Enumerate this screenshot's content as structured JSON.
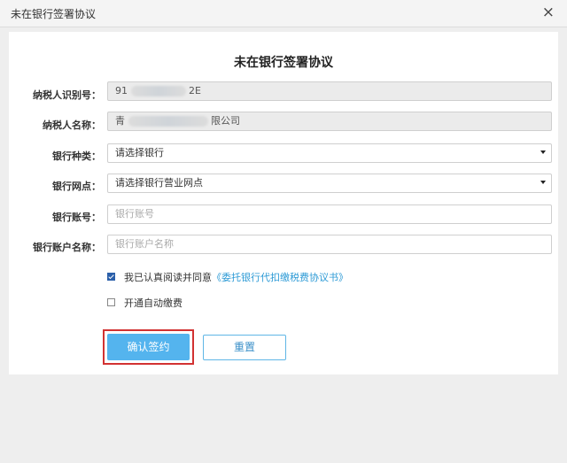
{
  "window": {
    "title": "未在银行签署协议",
    "close_glyph": "×"
  },
  "form": {
    "heading": "未在银行签署协议",
    "taxpayer_id": {
      "label": "纳税人识别号：",
      "value_prefix": "91",
      "value_suffix": "2E"
    },
    "taxpayer_name": {
      "label": "纳税人名称：",
      "value_prefix": "青",
      "value_suffix": "限公司"
    },
    "bank_type": {
      "label": "银行种类：",
      "value": "请选择银行"
    },
    "bank_branch": {
      "label": "银行网点：",
      "value": "请选择银行营业网点"
    },
    "bank_account": {
      "label": "银行账号：",
      "placeholder": "银行账号"
    },
    "bank_account_name": {
      "label": "银行账户名称：",
      "placeholder": "银行账户名称"
    },
    "agree": {
      "text": "我已认真阅读并同意",
      "link": "《委托银行代扣缴税费协议书》",
      "checked": true
    },
    "auto_pay": {
      "text": "开通自动缴费",
      "checked": false
    },
    "confirm_label": "确认签约",
    "reset_label": "重置"
  },
  "colors": {
    "primary": "#54b4ee",
    "highlight_border": "#d23232",
    "link": "#2e9bd6"
  }
}
